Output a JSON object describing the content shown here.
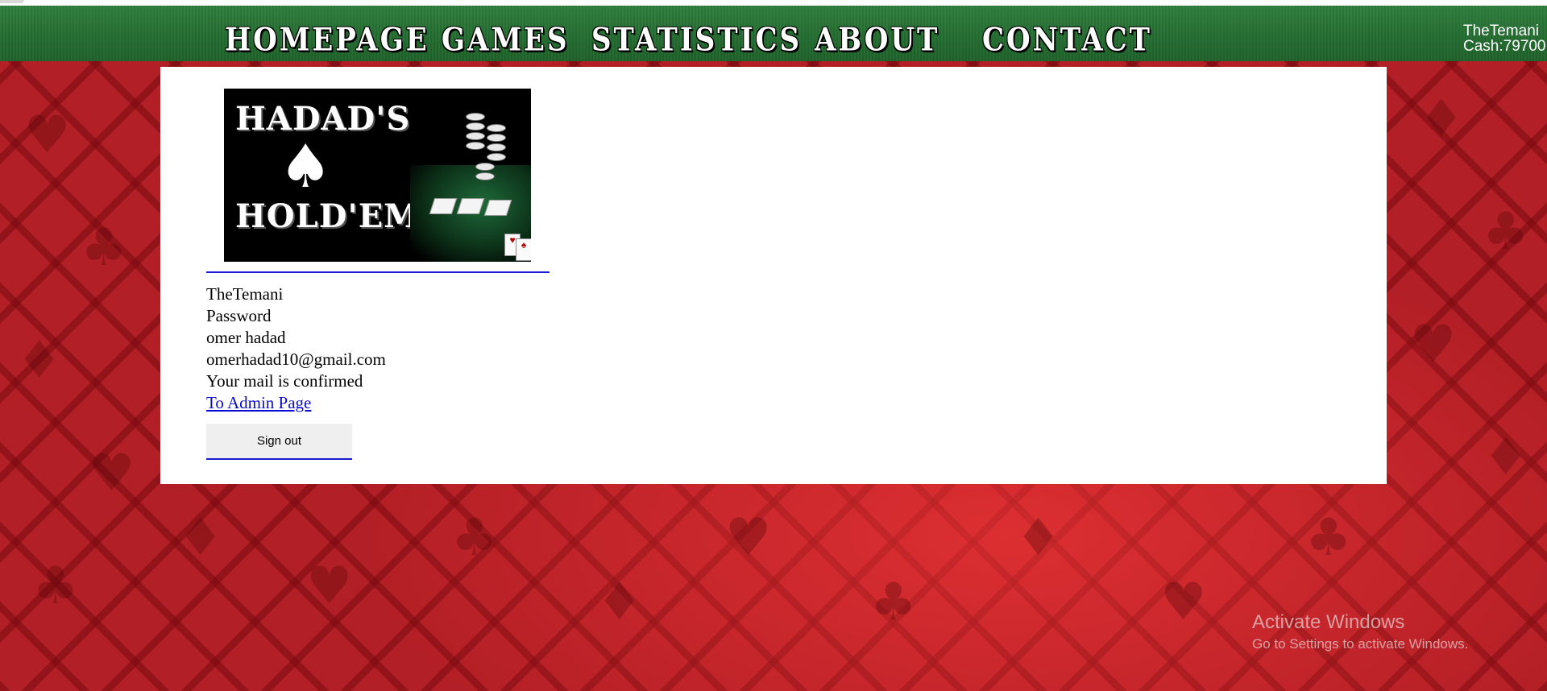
{
  "nav": {
    "items": [
      {
        "label": "HOMEPAGE"
      },
      {
        "label": "GAMES"
      },
      {
        "label": "STATISTICS"
      },
      {
        "label": "ABOUT"
      },
      {
        "label": "CONTACT"
      }
    ]
  },
  "user_status": {
    "username": "TheTemani",
    "cash": "Cash:79700"
  },
  "logo": {
    "line1": "HADAD'S",
    "line2": "HOLD'EM",
    "icon": "spade-icon"
  },
  "profile": {
    "username": "TheTemani",
    "password": "Password",
    "full_name": "omer hadad",
    "email": "omerhadad10@gmail.com",
    "mail_status": "Your mail is confirmed",
    "admin_link": "To Admin Page",
    "signout_label": "Sign out"
  },
  "watermark": {
    "title": "Activate Windows",
    "subtitle": "Go to Settings to activate Windows."
  },
  "colors": {
    "nav_green": "#226b30",
    "background_red": "#b31f26",
    "link_blue": "#0a0ad6",
    "divider_blue": "#1a1ad0"
  }
}
